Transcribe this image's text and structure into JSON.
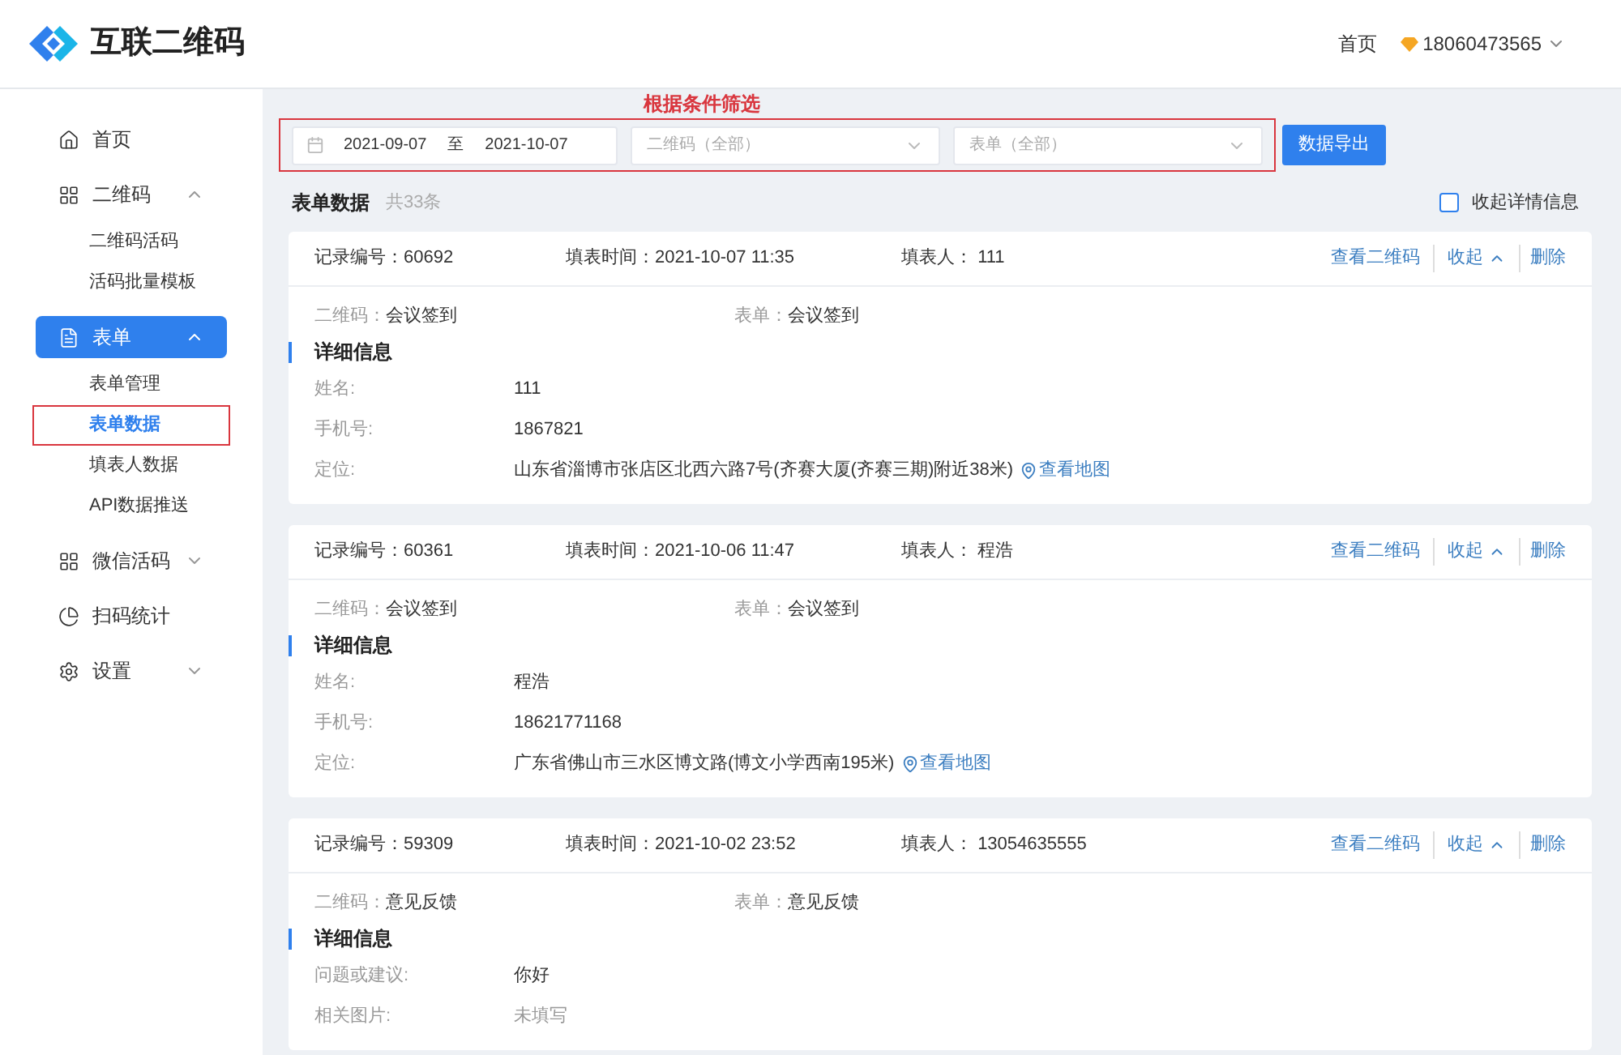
{
  "header": {
    "brand": "互联二维码",
    "nav_link": "首页",
    "account": "18060473565"
  },
  "sidebar": {
    "items": [
      {
        "label": "首页",
        "selected": false
      },
      {
        "label": "二维码",
        "selected": false,
        "expanded": true,
        "children": [
          {
            "label": "二维码活码",
            "selected": false,
            "annotated": false
          },
          {
            "label": "活码批量模板",
            "selected": false,
            "annotated": false
          }
        ]
      },
      {
        "label": "表单",
        "selected": true,
        "expanded": true,
        "children": [
          {
            "label": "表单管理",
            "selected": false,
            "annotated": false
          },
          {
            "label": "表单数据",
            "selected": true,
            "annotated": true
          },
          {
            "label": "填表人数据",
            "selected": false,
            "annotated": false
          },
          {
            "label": "API数据推送",
            "selected": false,
            "annotated": false
          }
        ]
      },
      {
        "label": "微信活码",
        "selected": false,
        "expanded": false
      },
      {
        "label": "扫码统计",
        "selected": false
      },
      {
        "label": "设置",
        "selected": false,
        "expanded": false
      }
    ]
  },
  "filters": {
    "annotation": "根据条件筛选",
    "date_from": "2021-09-07",
    "date_separator": "至",
    "date_to": "2021-10-07",
    "qrcode_select": {
      "placeholder": "二维码（全部）"
    },
    "form_select": {
      "placeholder": "表单（全部）"
    },
    "export_button": "数据导出"
  },
  "list": {
    "title": "表单数据",
    "count": "共33条",
    "collapse_toggle": {
      "label": "收起详情信息",
      "checked": false
    }
  },
  "records": [
    {
      "id_label": "记录编号：",
      "id": "60692",
      "time_label": "填表时间：",
      "time": "2021-10-07 11:35",
      "filler_label": "填表人：",
      "filler": "111",
      "actions": {
        "view_qr": "查看二维码",
        "collapse": "收起",
        "delete": "删除"
      },
      "expanded": true,
      "qrcode_label": "二维码：",
      "qrcode": "会议签到",
      "form_label": "表单：",
      "form": "会议签到",
      "section_title": "详细信息",
      "fields": [
        {
          "label": "姓名:",
          "value": "111",
          "muted": false
        },
        {
          "label": "手机号:",
          "value": "1867821",
          "muted": false
        },
        {
          "label": "定位:",
          "value": "山东省淄博市张店区北西六路7号(齐赛大厦(齐赛三期)附近38米)",
          "muted": false,
          "map_link": "查看地图"
        }
      ]
    },
    {
      "id_label": "记录编号：",
      "id": "60361",
      "time_label": "填表时间：",
      "time": "2021-10-06 11:47",
      "filler_label": "填表人：",
      "filler": "程浩",
      "actions": {
        "view_qr": "查看二维码",
        "collapse": "收起",
        "delete": "删除"
      },
      "expanded": true,
      "qrcode_label": "二维码：",
      "qrcode": "会议签到",
      "form_label": "表单：",
      "form": "会议签到",
      "section_title": "详细信息",
      "fields": [
        {
          "label": "姓名:",
          "value": "程浩",
          "muted": false
        },
        {
          "label": "手机号:",
          "value": "18621771168",
          "muted": false
        },
        {
          "label": "定位:",
          "value": "广东省佛山市三水区博文路(博文小学西南195米)",
          "muted": false,
          "map_link": "查看地图"
        }
      ]
    },
    {
      "id_label": "记录编号：",
      "id": "59309",
      "time_label": "填表时间：",
      "time": "2021-10-02 23:52",
      "filler_label": "填表人：",
      "filler": "13054635555",
      "actions": {
        "view_qr": "查看二维码",
        "collapse": "收起",
        "delete": "删除"
      },
      "expanded": true,
      "qrcode_label": "二维码：",
      "qrcode": "意见反馈",
      "form_label": "表单：",
      "form": "意见反馈",
      "section_title": "详细信息",
      "fields": [
        {
          "label": "问题或建议:",
          "value": "你好",
          "muted": false
        },
        {
          "label": "相关图片:",
          "value": "未填写",
          "muted": true
        }
      ]
    }
  ]
}
